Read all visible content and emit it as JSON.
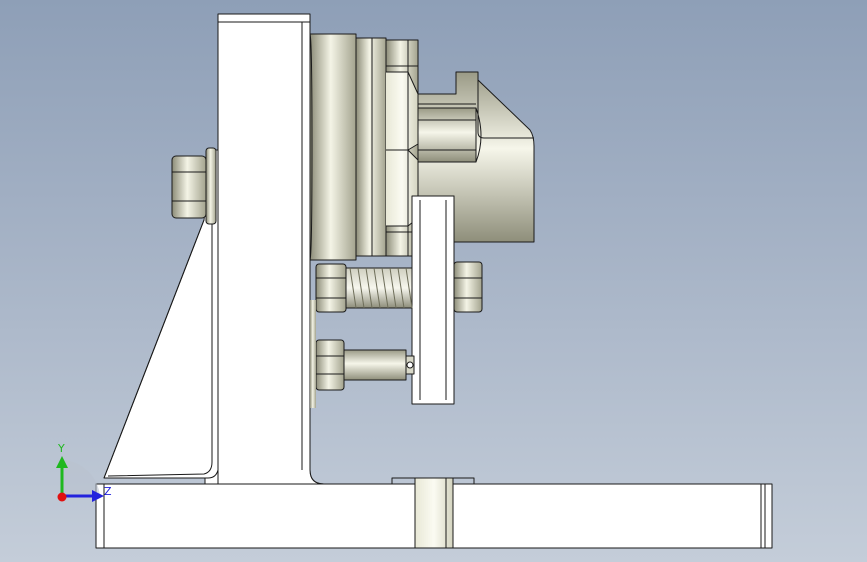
{
  "viewport": {
    "background_top": "#8e9fb7",
    "background_bottom": "#c4cdd9"
  },
  "triad": {
    "y_label": "Y",
    "z_label": "Z",
    "y_color": "#1fb81f",
    "z_color": "#2222dd",
    "x_color": "#e01010"
  },
  "model": {
    "part_fill": "#ffffff",
    "edge_color": "#1a1a1a",
    "metal_light": "#f4f4e6",
    "metal_dark": "#8c8c78"
  }
}
